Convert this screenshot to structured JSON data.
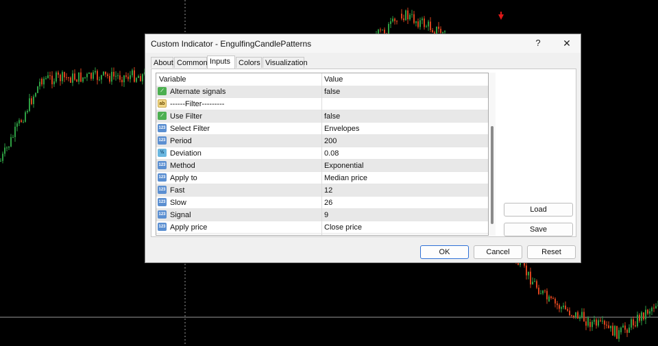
{
  "dialog": {
    "title": "Custom Indicator - EngulfingCandlePatterns",
    "help_label": "?",
    "close_label": "✕"
  },
  "tabs": [
    {
      "label": "About"
    },
    {
      "label": "Common"
    },
    {
      "label": "Inputs"
    },
    {
      "label": "Colors"
    },
    {
      "label": "Visualization"
    }
  ],
  "grid": {
    "col_variable": "Variable",
    "col_value": "Value",
    "rows": [
      {
        "icon": "bool-icon",
        "icon_text": "⟋",
        "variable": "Alternate signals",
        "value": "false"
      },
      {
        "icon": "string-icon",
        "icon_text": "ab",
        "variable": "------Filter---------",
        "value": ""
      },
      {
        "icon": "bool-icon",
        "icon_text": "⟋",
        "variable": "Use Filter",
        "value": "false"
      },
      {
        "icon": "int-icon",
        "icon_text": "123",
        "variable": "Select Filter",
        "value": "Envelopes"
      },
      {
        "icon": "int-icon",
        "icon_text": "123",
        "variable": "Period",
        "value": "200"
      },
      {
        "icon": "double-icon",
        "icon_text": "½",
        "variable": "Deviation",
        "value": "0.08"
      },
      {
        "icon": "int-icon",
        "icon_text": "123",
        "variable": "Method",
        "value": "Exponential"
      },
      {
        "icon": "int-icon",
        "icon_text": "123",
        "variable": "Apply to",
        "value": "Median price"
      },
      {
        "icon": "int-icon",
        "icon_text": "123",
        "variable": "Fast",
        "value": "12"
      },
      {
        "icon": "int-icon",
        "icon_text": "123",
        "variable": "Slow",
        "value": "26"
      },
      {
        "icon": "int-icon",
        "icon_text": "123",
        "variable": "Signal",
        "value": "9"
      },
      {
        "icon": "int-icon",
        "icon_text": "123",
        "variable": "Apply price",
        "value": "Close price"
      }
    ]
  },
  "buttons": {
    "load": "Load",
    "save": "Save",
    "ok": "OK",
    "cancel": "Cancel",
    "reset": "Reset"
  },
  "colors": {
    "background": "#000000",
    "bull_candle": "#2ea043",
    "bear_candle": "#d9441e",
    "signal_arrow": "#e01818"
  }
}
